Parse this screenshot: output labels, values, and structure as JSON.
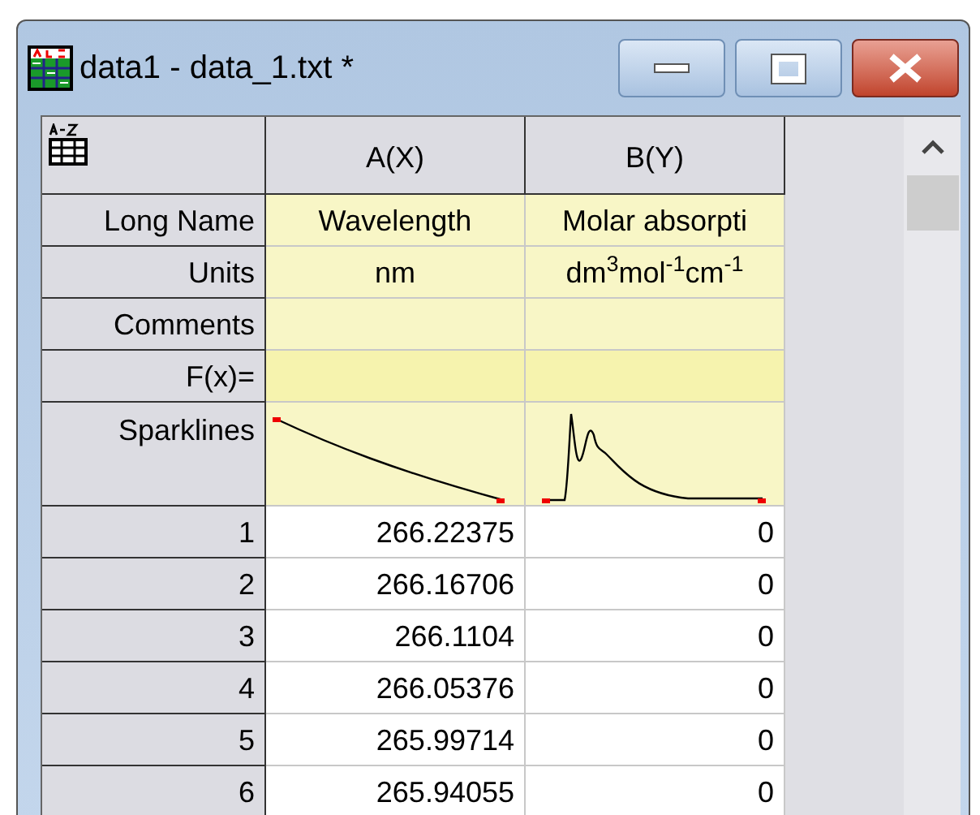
{
  "window": {
    "title": "data1 - data_1.txt *"
  },
  "columns": [
    {
      "label": "A(X)"
    },
    {
      "label": "B(Y)"
    }
  ],
  "label_rows": [
    {
      "label": "Long Name",
      "cells": [
        "Wavelength",
        "Molar absorpti"
      ]
    },
    {
      "label": "Units",
      "cells": [
        "nm",
        "dm$^{3}$mol$^{-1}$cm$^{-1}$"
      ]
    },
    {
      "label": "Comments"
    },
    {
      "label": "F(x)="
    }
  ],
  "sparklines": {
    "label": "Sparklines"
  },
  "rows": [
    {
      "label": "1",
      "cells": [
        "266.22375",
        "0"
      ]
    },
    {
      "label": "2",
      "cells": [
        "266.16706",
        "0"
      ]
    },
    {
      "label": "3",
      "cells": [
        "266.1104",
        "0"
      ]
    },
    {
      "label": "4",
      "cells": [
        "266.05376",
        "0"
      ]
    },
    {
      "label": "5",
      "cells": [
        "265.99714",
        "0"
      ]
    },
    {
      "label": "6",
      "cells": [
        "265.94055",
        "0"
      ]
    }
  ]
}
